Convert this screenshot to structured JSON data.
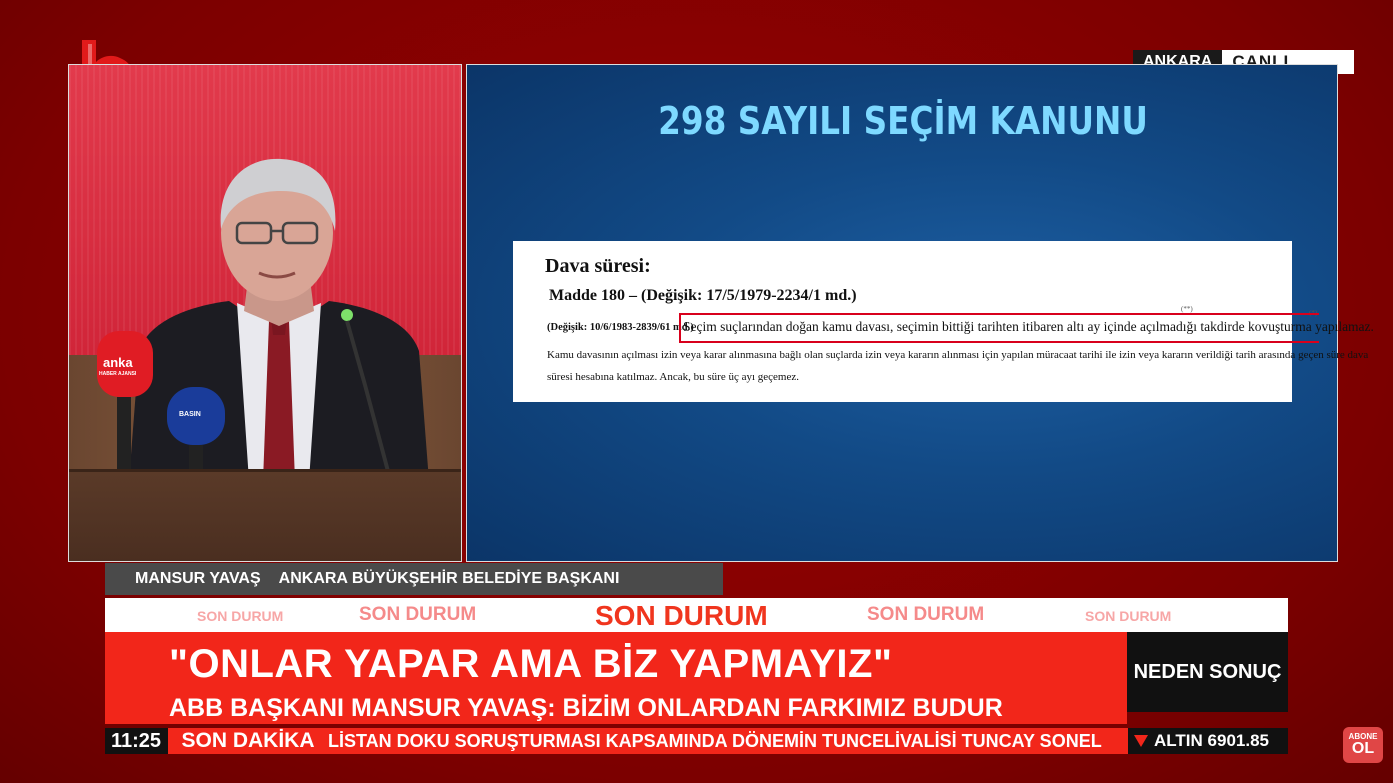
{
  "channel": {
    "logo_text": "halk",
    "location": "ANKARA",
    "live_label": "CANLI"
  },
  "slide": {
    "title": "298 SAYILI SEÇİM KANUNU",
    "doc_heading": "Dava süresi:",
    "doc_article": "Madde 180 – (Değişik: 17/5/1979-2234/1 md.)",
    "doc_amend_prefix": "(Değişik: 10/6/1983-2839/61 md.)",
    "doc_highlight": "Seçim suçlarından doğan kamu davası, seçimin bittiği tarihten itibaren altı ay içinde açılmadığı takdirde kovuşturma yapılamaz.",
    "doc_line2": "Kamu davasının açılması izin veya karar alınmasına bağlı olan suçlarda izin veya kararın alınması için yapılan müracaat tarihi ile izin veya kararın verildiği tarih arasında geçen süre dava",
    "doc_line3": "süresi hesabına katılmaz. Ancak, bu süre üç ayı geçemez.",
    "doc_mark": "(**)",
    "doc_mark2": "(*)"
  },
  "speaker": {
    "mic_brand_1": "anka",
    "mic_brand_1_sub": "HABER AJANSI",
    "mic_brand_2": "BASIN"
  },
  "lower_third": {
    "name": "MANSUR YAVAŞ",
    "role": "ANKARA BÜYÜKŞEHİR BELEDİYE BAŞKANI",
    "son_durum": "SON DURUM",
    "headline": "\"ONLAR YAPAR AMA BİZ YAPMAYIZ\"",
    "subheadline": "ABB BAŞKANI MANSUR YAVAŞ: BİZİM ONLARDAN FARKIMIZ BUDUR",
    "program": "NEDEN SONUÇ"
  },
  "ticker": {
    "time": "11:25",
    "label": "SON DAKİKA",
    "news": "LİSTAN DOKU SORUŞTURMASI KAPSAMINDA DÖNEMİN TUNCELİVALİSİ TUNCAY SONEL",
    "market_name": "ALTIN",
    "market_value": "6901.85",
    "trend_icon": "down-triangle-icon"
  },
  "subscribe": {
    "line1": "ABONE",
    "line2": "OL"
  },
  "colors": {
    "brand_red": "#f2261a",
    "frame_red": "#8e0000",
    "slide_title": "#7ed9ff"
  }
}
